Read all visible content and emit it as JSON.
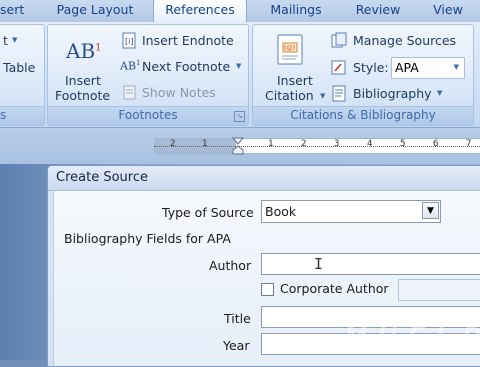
{
  "tabs": [
    "sert",
    "Page Layout",
    "References",
    "Mailings",
    "Review",
    "View"
  ],
  "active_tab": "References",
  "ribbon": {
    "left_group": {
      "item1": "t",
      "item2": "Table",
      "label": "s"
    },
    "footnotes": {
      "insert_footnote_line1": "Insert",
      "insert_footnote_line2": "Footnote",
      "insert_endnote": "Insert Endnote",
      "next_footnote": "Next Footnote",
      "show_notes": "Show Notes",
      "group_label": "Footnotes"
    },
    "citations": {
      "insert_citation_line1": "Insert",
      "insert_citation_line2": "Citation",
      "manage_sources": "Manage Sources",
      "style_label": "Style:",
      "style_value": "APA",
      "bibliography": "Bibliography",
      "group_label": "Citations & Bibliography"
    }
  },
  "ruler": [
    "2",
    "1",
    "1",
    "2",
    "3",
    "4",
    "5",
    "6",
    "7"
  ],
  "dialog": {
    "title": "Create Source",
    "type_of_source_label": "Type of Source",
    "type_of_source_value": "Book",
    "section_label": "Bibliography Fields for APA",
    "author_label": "Author",
    "author_value": "",
    "corporate_author_label": "Corporate Author",
    "title_label": "Title",
    "title_value": "",
    "year_label": "Year",
    "year_value": ""
  },
  "watermark": "M H E L P"
}
